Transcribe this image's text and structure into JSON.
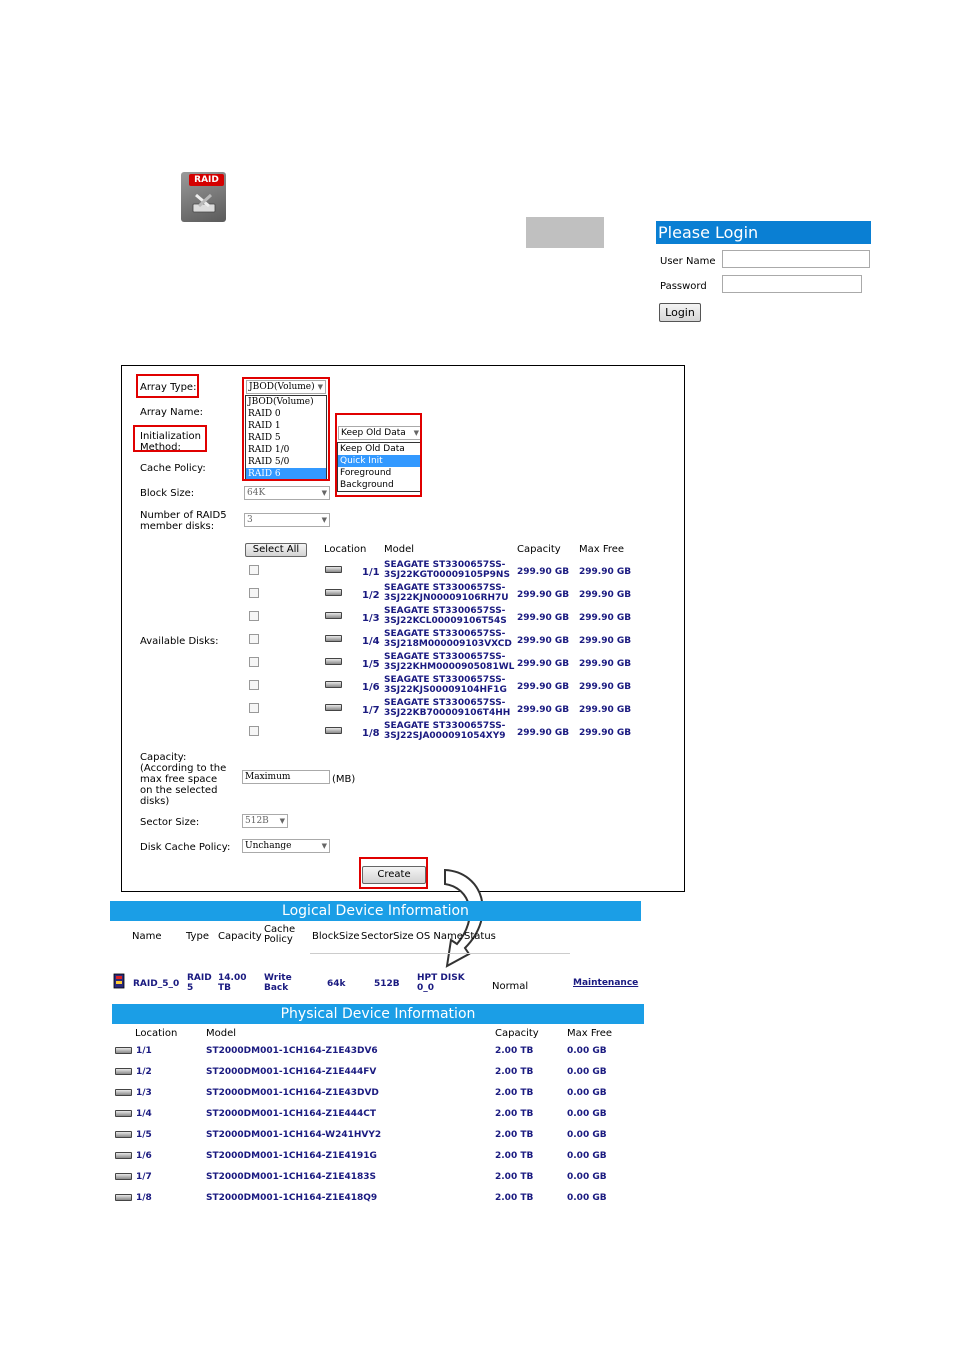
{
  "top": {
    "raid_icon_text": "RAID",
    "login": {
      "title": "Please Login",
      "username_label": "User Name",
      "password_label": "Password",
      "login_button": "Login"
    }
  },
  "form": {
    "array_type_label": "Array Type:",
    "array_type_value": "JBOD(Volume)",
    "array_type_options": [
      "JBOD(Volume)",
      "RAID 0",
      "RAID 1",
      "RAID 5",
      "RAID 1/0",
      "RAID 5/0",
      "RAID 6"
    ],
    "array_type_highlight": "RAID 6",
    "array_name_label": "Array Name:",
    "init_method_label": "Initialization Method:",
    "init_method_value": "Keep Old Data",
    "init_method_options": [
      "Keep Old Data",
      "Quick Init",
      "Foreground",
      "Background"
    ],
    "init_method_highlight": "Quick Init",
    "cache_policy_label": "Cache Policy:",
    "block_size_label": "Block Size:",
    "block_size_value": "64K",
    "member_disks_label": "Number of RAID5 member disks:",
    "member_disks_value": "3",
    "select_all_button": "Select All",
    "columns": {
      "location": "Location",
      "model": "Model",
      "capacity": "Capacity",
      "max_free": "Max Free"
    },
    "available_disks_label": "Available Disks:",
    "disks": [
      {
        "loc": "1/1",
        "model1": "SEAGATE ST3300657SS-",
        "model2": "3SJ22KGT00009105P9NS",
        "capacity": "299.90 GB",
        "free": "299.90 GB"
      },
      {
        "loc": "1/2",
        "model1": "SEAGATE ST3300657SS-",
        "model2": "3SJ22KJN00009106RH7U",
        "capacity": "299.90 GB",
        "free": "299.90 GB"
      },
      {
        "loc": "1/3",
        "model1": "SEAGATE ST3300657SS-",
        "model2": "3SJ22KCL00009106T54S",
        "capacity": "299.90 GB",
        "free": "299.90 GB"
      },
      {
        "loc": "1/4",
        "model1": "SEAGATE ST3300657SS-",
        "model2": "3SJ218M000009103VXCD",
        "capacity": "299.90 GB",
        "free": "299.90 GB"
      },
      {
        "loc": "1/5",
        "model1": "SEAGATE ST3300657SS-",
        "model2": "3SJ22KHM0000905081WL",
        "capacity": "299.90 GB",
        "free": "299.90 GB"
      },
      {
        "loc": "1/6",
        "model1": "SEAGATE ST3300657SS-",
        "model2": "3SJ22KJS00009104HF1G",
        "capacity": "299.90 GB",
        "free": "299.90 GB"
      },
      {
        "loc": "1/7",
        "model1": "SEAGATE ST3300657SS-",
        "model2": "3SJ22KB700009106T4HH",
        "capacity": "299.90 GB",
        "free": "299.90 GB"
      },
      {
        "loc": "1/8",
        "model1": "SEAGATE ST3300657SS-",
        "model2": "3SJ22SJA000091054XY9",
        "capacity": "299.90 GB",
        "free": "299.90 GB"
      }
    ],
    "capacity_label": "Capacity: (According to the max free space on the selected disks)",
    "capacity_value": "Maximum",
    "capacity_unit": "(MB)",
    "sector_size_label": "Sector Size:",
    "sector_size_value": "512B",
    "disk_cache_label": "Disk Cache Policy:",
    "disk_cache_value": "Unchange",
    "create_button": "Create"
  },
  "logical": {
    "title": "Logical Device Information",
    "columns": {
      "name": "Name",
      "type": "Type",
      "capacity": "Capacity",
      "cache": "Cache Policy",
      "block": "BlockSize",
      "sector": "SectorSize",
      "os": "OS Name",
      "status": "Status"
    },
    "row": {
      "name": "RAID_5_0",
      "type": "RAID 5",
      "capacity": "14.00 TB",
      "cache": "Write Back",
      "block": "64k",
      "sector": "512B",
      "os": "HPT DISK 0_0",
      "status": "Normal",
      "action": "Maintenance"
    }
  },
  "physical": {
    "title": "Physical Device Information",
    "columns": {
      "location": "Location",
      "model": "Model",
      "capacity": "Capacity",
      "max_free": "Max Free"
    },
    "disks": [
      {
        "loc": "1/1",
        "model": "ST2000DM001-1CH164-Z1E43DV6",
        "capacity": "2.00 TB",
        "free": "0.00 GB"
      },
      {
        "loc": "1/2",
        "model": "ST2000DM001-1CH164-Z1E444FV",
        "capacity": "2.00 TB",
        "free": "0.00 GB"
      },
      {
        "loc": "1/3",
        "model": "ST2000DM001-1CH164-Z1E43DVD",
        "capacity": "2.00 TB",
        "free": "0.00 GB"
      },
      {
        "loc": "1/4",
        "model": "ST2000DM001-1CH164-Z1E444CT",
        "capacity": "2.00 TB",
        "free": "0.00 GB"
      },
      {
        "loc": "1/5",
        "model": "ST2000DM001-1CH164-W241HVY2",
        "capacity": "2.00 TB",
        "free": "0.00 GB"
      },
      {
        "loc": "1/6",
        "model": "ST2000DM001-1CH164-Z1E4191G",
        "capacity": "2.00 TB",
        "free": "0.00 GB"
      },
      {
        "loc": "1/7",
        "model": "ST2000DM001-1CH164-Z1E4183S",
        "capacity": "2.00 TB",
        "free": "0.00 GB"
      },
      {
        "loc": "1/8",
        "model": "ST2000DM001-1CH164-Z1E418Q9",
        "capacity": "2.00 TB",
        "free": "0.00 GB"
      }
    ]
  },
  "colors": {
    "highlight_red": "#e00000",
    "header_blue": "#1b9ee6",
    "login_blue": "#0a7fd3",
    "text_blue": "#1a1a80",
    "select_blue": "#3399ff"
  }
}
